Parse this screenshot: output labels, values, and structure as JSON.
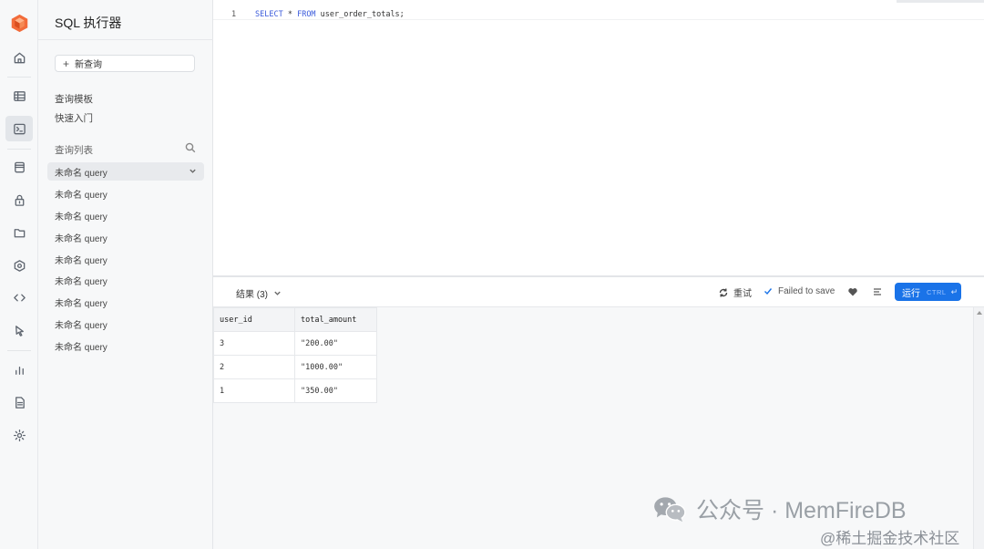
{
  "sidebar": {
    "title": "SQL 执行器",
    "new_query_label": "新查询",
    "links": [
      "查询模板",
      "快速入门"
    ],
    "query_list_header": "查询列表",
    "queries": [
      "未命名 query",
      "未命名 query",
      "未命名 query",
      "未命名 query",
      "未命名 query",
      "未命名 query",
      "未命名 query",
      "未命名 query",
      "未命名 query"
    ]
  },
  "editor": {
    "line_number": "1",
    "code_keyword_select": "SELECT",
    "code_star": " * ",
    "code_keyword_from": "FROM",
    "code_rest": " user_order_totals;"
  },
  "results": {
    "tab_label": "结果 (3)",
    "retry_label": "重试",
    "save_status": "Failed to save",
    "run_label": "运行",
    "run_shortcut": "CTRL",
    "run_enter_glyph": "↵",
    "columns": [
      "user_id",
      "total_amount"
    ],
    "rows": [
      [
        "3",
        "\"200.00\""
      ],
      [
        "2",
        "\"1000.00\""
      ],
      [
        "1",
        "\"350.00\""
      ]
    ]
  },
  "watermark": {
    "line1": "公众号 · MemFireDB",
    "line2": "@稀土掘金技术社区"
  },
  "colors": {
    "accent": "#1a73e8",
    "logo": "#f26b3a"
  },
  "icons": [
    "logo-icon",
    "home-icon",
    "table-icon",
    "sql-terminal-icon",
    "database-icon",
    "auth-lock-icon",
    "storage-icon",
    "functions-icon",
    "api-code-icon",
    "realtime-icon",
    "reports-icon",
    "logs-icon",
    "settings-icon",
    "search-icon",
    "chevron-down-icon",
    "retry-icon",
    "check-icon",
    "heart-icon",
    "format-icon",
    "wechat-icon"
  ]
}
